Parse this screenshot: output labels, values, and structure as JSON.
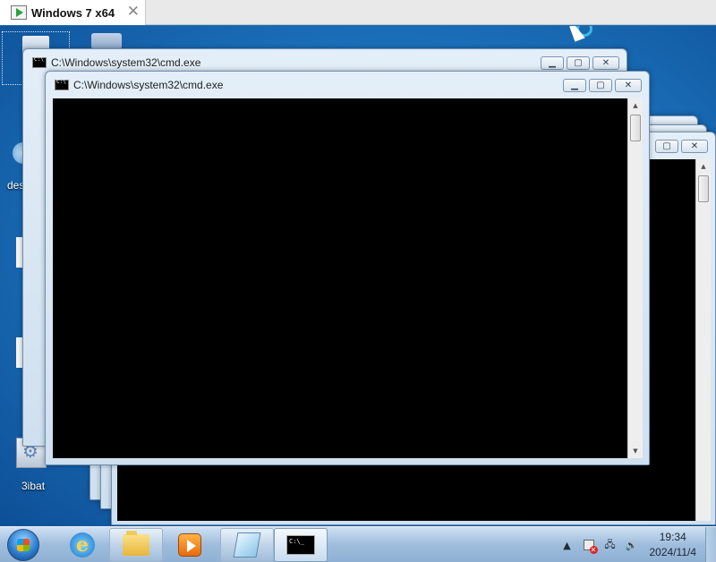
{
  "vm": {
    "tab_title": "Windows 7 x64",
    "close_glyph": "✕"
  },
  "desktop": {
    "label_partial_1": "des",
    "label_partial_2": "3ibat"
  },
  "windows": [
    {
      "title": "C:\\Windows\\system32\\cmd.exe"
    },
    {
      "title": "C:\\Windows\\system32\\cmd.exe"
    }
  ],
  "caption": {
    "minimize": "▁",
    "maximize": "▢",
    "close": "✕"
  },
  "taskbar": {
    "console_text": "C:\\_",
    "clock_time": "19:34",
    "clock_date": "2024/11/4",
    "tray_arrow": "▲"
  },
  "icons": {
    "start": "windows-logo-icon",
    "browser": "internet-explorer-icon",
    "explorer": "folder-icon",
    "media": "media-player-icon",
    "notepad": "notepad-icon",
    "console": "cmd-icon",
    "flag": "action-center-flag-icon",
    "network": "network-icon",
    "volume": "volume-icon"
  }
}
